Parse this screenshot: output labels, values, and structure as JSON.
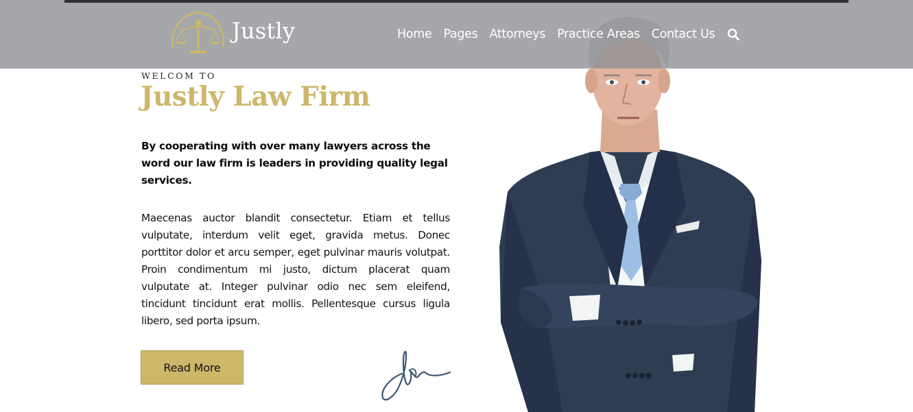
{
  "header": {
    "logo": {
      "text": "Justly",
      "icon": "scales-of-justice-icon"
    },
    "nav": [
      {
        "label": "Home"
      },
      {
        "label": "Pages"
      },
      {
        "label": "Attorneys"
      },
      {
        "label": "Practice Areas"
      },
      {
        "label": "Contact Us"
      }
    ],
    "search_icon": "search-icon"
  },
  "hero": {
    "eyebrow": "WELCOM TO",
    "title": "Justly Law Firm",
    "lead": "By cooperating with over many lawyers across the word our law firm is leaders in providing quality legal services.",
    "body": "Maecenas auctor blandit consectetur. Etiam et tellus vulputate, interdum velit eget, gravida metus. Donec porttitor dolor et arcu semper, eget pulvinar mauris volutpat. Proin condimentum mi justo, dictum placerat quam vulputate at. Integer pulvinar odio nec sem eleifend, tincidunt tincidunt erat mollis. Pellentesque cursus ligula libero, sed porta ipsum.",
    "button_label": "Read More",
    "signature_icon": "signature-icon",
    "portrait": "attorney-portrait"
  },
  "colors": {
    "accent": "#cdb76a",
    "header_bg": "#8c8e92",
    "topbar": "#2e3034",
    "suit": "#2f3d52",
    "tie": "#9cbfe3"
  }
}
